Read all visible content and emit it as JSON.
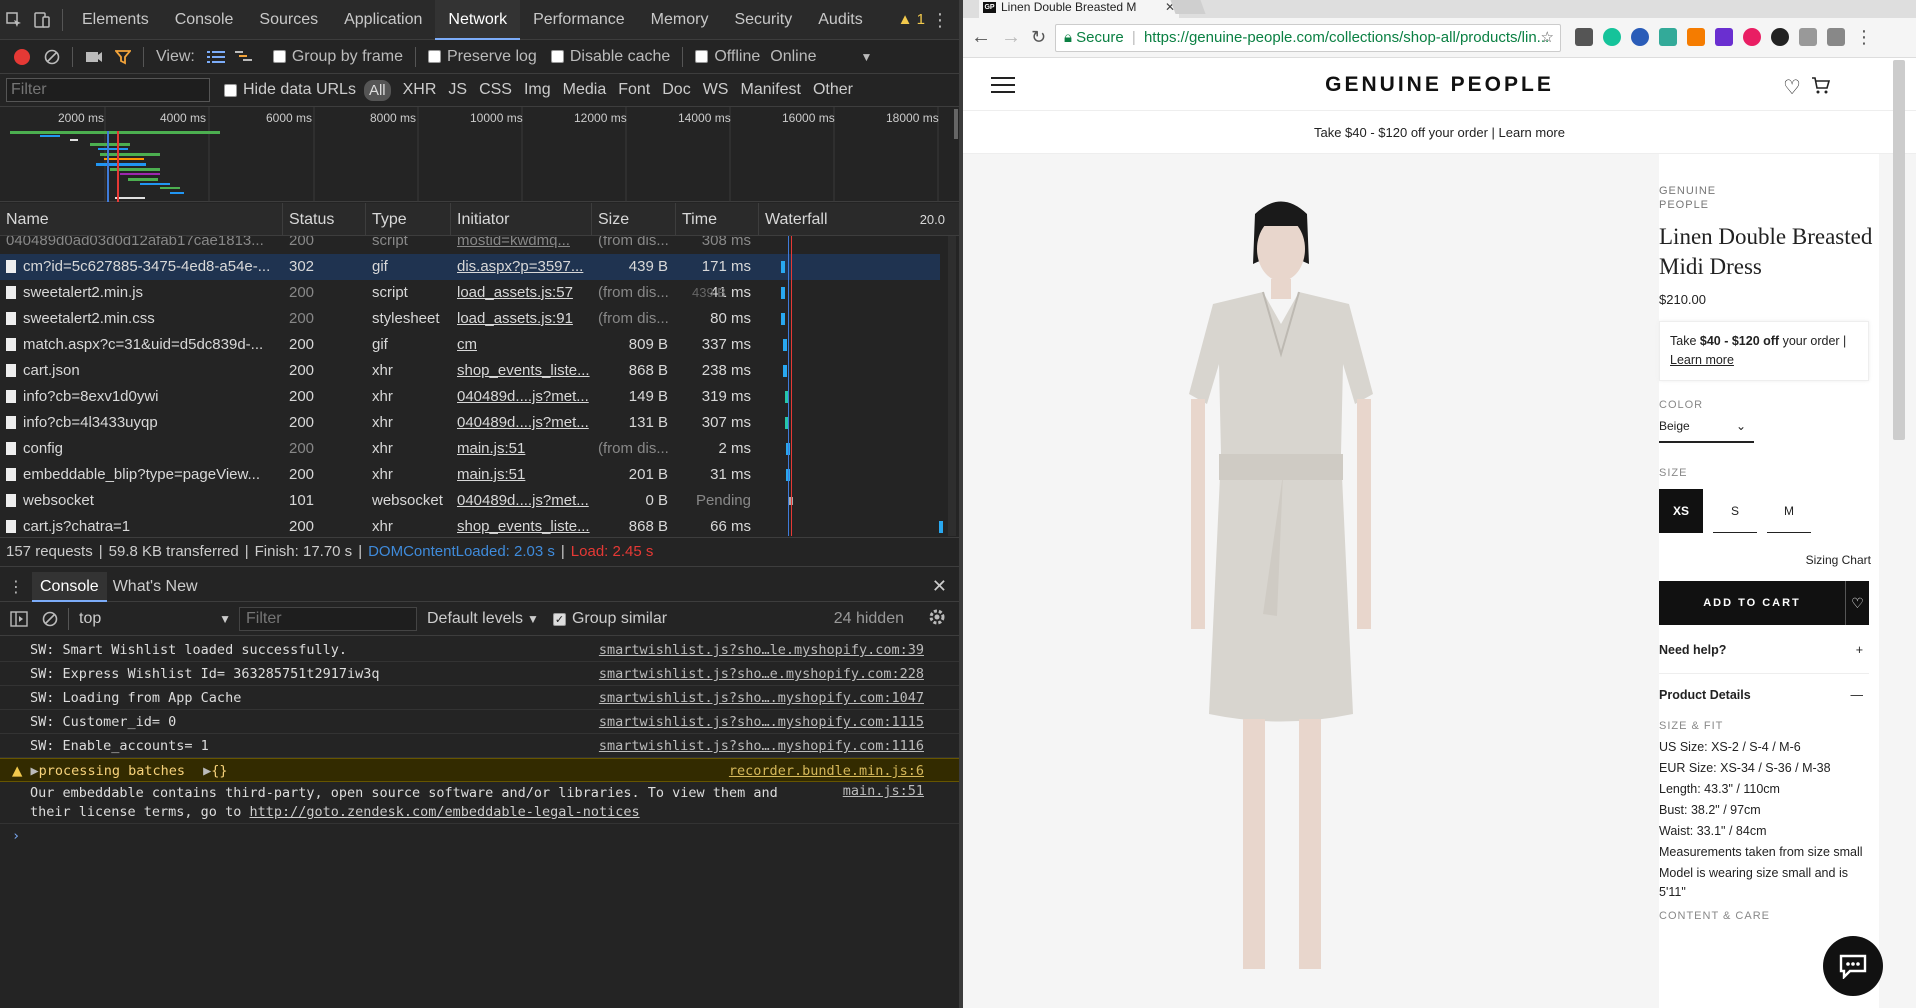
{
  "devtools": {
    "tabs": [
      "Elements",
      "Console",
      "Sources",
      "Application",
      "Network",
      "Performance",
      "Memory",
      "Security",
      "Audits"
    ],
    "active_tab": "Network",
    "warning_count": "1",
    "toolbar": {
      "view_label": "View:",
      "group_by_frame": "Group by frame",
      "preserve_log": "Preserve log",
      "disable_cache": "Disable cache",
      "offline": "Offline",
      "throttling": "Online"
    },
    "filter": {
      "placeholder": "Filter",
      "hide_data_urls": "Hide data URLs",
      "types": [
        "All",
        "XHR",
        "JS",
        "CSS",
        "Img",
        "Media",
        "Font",
        "Doc",
        "WS",
        "Manifest",
        "Other"
      ]
    },
    "overview_ticks": [
      "2000 ms",
      "4000 ms",
      "6000 ms",
      "8000 ms",
      "10000 ms",
      "12000 ms",
      "14000 ms",
      "16000 ms",
      "18000 ms"
    ],
    "columns": [
      "Name",
      "Status",
      "Type",
      "Initiator",
      "Size",
      "Time",
      "Waterfall"
    ],
    "waterfall_scale": "20.0",
    "partial_row": {
      "name": "040489d0ad03d0d12afab17cae1813...",
      "status": "200",
      "type": "script",
      "initiator": "mostid=kwdmq...",
      "size": "(from dis...",
      "time": "308 ms"
    },
    "rows": [
      {
        "name": "cm?id=5c627885-3475-4ed8-a54e-...",
        "status": "302",
        "type": "gif",
        "initiator": "dis.aspx?p=3597...",
        "size": "439 B",
        "time": "171 ms",
        "bar": 0.1
      },
      {
        "name": "sweetalert2.min.js",
        "status": "200",
        "type": "script",
        "initiator": "load_assets.js:57",
        "size": "(from dis...",
        "size2": "439 B",
        "time": "41 ms",
        "bar": 0.1
      },
      {
        "name": "sweetalert2.min.css",
        "status": "200",
        "type": "stylesheet",
        "initiator": "load_assets.js:91",
        "size": "(from dis...",
        "time": "80 ms",
        "bar": 0.1
      },
      {
        "name": "match.aspx?c=31&uid=d5dc839d-...",
        "status": "200",
        "type": "gif",
        "initiator": "cm",
        "size": "809 B",
        "time": "337 ms",
        "bar": 0.11
      },
      {
        "name": "cart.json",
        "status": "200",
        "type": "xhr",
        "initiator": "shop_events_liste...",
        "size": "868 B",
        "time": "238 ms",
        "bar": 0.11
      },
      {
        "name": "info?cb=8exv1d0ywi",
        "status": "200",
        "type": "xhr",
        "initiator": "040489d....js?met...",
        "size": "149 B",
        "time": "319 ms",
        "bar": 0.12
      },
      {
        "name": "info?cb=4l3433uyqp",
        "status": "200",
        "type": "xhr",
        "initiator": "040489d....js?met...",
        "size": "131 B",
        "time": "307 ms",
        "bar": 0.12
      },
      {
        "name": "config",
        "status": "200",
        "type": "xhr",
        "initiator": "main.js:51",
        "size": "(from dis...",
        "time": "2 ms",
        "bar": 0.13
      },
      {
        "name": "embeddable_blip?type=pageView...",
        "status": "200",
        "type": "xhr",
        "initiator": "main.js:51",
        "size": "201 B",
        "time": "31 ms",
        "bar": 0.13
      },
      {
        "name": "websocket",
        "status": "101",
        "type": "websocket",
        "initiator": "040489d....js?met...",
        "size": "0 B",
        "time": "Pending",
        "bar": 0.14
      },
      {
        "name": "cart.js?chatra=1",
        "status": "200",
        "type": "xhr",
        "initiator": "shop_events_liste...",
        "size": "868 B",
        "time": "66 ms",
        "bar": 0.98
      }
    ],
    "summary": {
      "requests": "157 requests",
      "transferred": "59.8 KB transferred",
      "finish": "Finish: 17.70 s",
      "dcl": "DOMContentLoaded: 2.03 s",
      "load": "Load: 2.45 s"
    },
    "drawer_tabs": [
      "Console",
      "What's New"
    ],
    "console_bar": {
      "context": "top",
      "filter_placeholder": "Filter",
      "levels": "Default levels",
      "group_similar": "Group similar",
      "hidden": "24 hidden"
    },
    "console_lines": [
      {
        "text": "SW: Smart Wishlist loaded successfully.",
        "src": "smartwishlist.js?sho…le.myshopify.com:39"
      },
      {
        "text": "SW: Express Wishlist Id= 363285751t2917iw3q",
        "src": "smartwishlist.js?sho…e.myshopify.com:228"
      },
      {
        "text": "SW: Loading from App Cache",
        "src": "smartwishlist.js?sho….myshopify.com:1047"
      },
      {
        "text": "SW: Customer_id= 0",
        "src": "smartwishlist.js?sho….myshopify.com:1115"
      },
      {
        "text": "SW: Enable_accounts= 1",
        "src": "smartwishlist.js?sho….myshopify.com:1116"
      }
    ],
    "warning_line": {
      "text": "processing batches",
      "obj": "{}",
      "src": "recorder.bundle.min.js:6"
    },
    "info_line": {
      "line1": "Our embeddable contains third-party, open source software and/or libraries. To view them and",
      "line2_prefix": "their license terms, go to ",
      "link": "http://goto.zendesk.com/embeddable-legal-notices",
      "src": "main.js:51"
    }
  },
  "browser": {
    "tab_title": "Linen Double Breasted M",
    "secure_label": "Secure",
    "url": "https://genuine-people.com/collections/shop-all/products/lin..."
  },
  "site": {
    "logo": "GENUINE PEOPLE",
    "promo": "Take $40 - $120 off your order | Learn more",
    "brand": "GENUINE PEOPLE",
    "product_title": "Linen Double Breasted Midi Dress",
    "price": "$210.00",
    "offer": {
      "pre": "Take ",
      "amount": "$40 - $120 off",
      "post": " your order | ",
      "link": "Learn more"
    },
    "color_label": "COLOR",
    "color_value": "Beige",
    "size_label": "SIZE",
    "sizes": [
      "XS",
      "S",
      "M"
    ],
    "selected_size": "XS",
    "sizing_chart": "Sizing Chart",
    "add_to_cart": "ADD TO CART",
    "need_help": "Need help?",
    "product_details": "Product Details",
    "size_fit_label": "SIZE & FIT",
    "details": [
      "US Size: XS-2 / S-4 / M-6",
      "EUR Size: XS-34 / S-36 / M-38",
      "Length: 43.3\" / 110cm",
      "Bust: 38.2\" / 97cm",
      "Waist: 33.1\" / 84cm",
      "Measurements taken from size small",
      "Model is wearing size small and is 5'11\""
    ],
    "content_care": "CONTENT & CARE"
  }
}
